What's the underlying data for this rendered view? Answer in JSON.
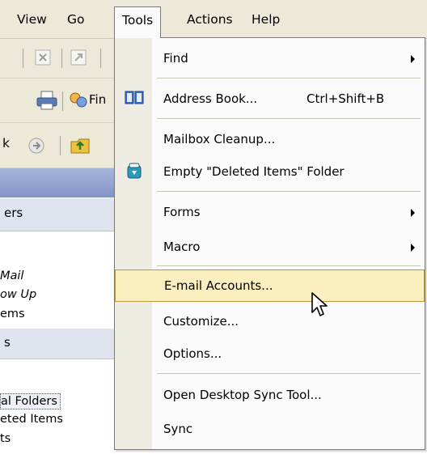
{
  "menubar": {
    "items": [
      {
        "label": "View"
      },
      {
        "label": "Go"
      },
      {
        "label": "Tools"
      },
      {
        "label": "Actions"
      },
      {
        "label": "Help"
      }
    ]
  },
  "toolbar": {
    "find_label": "Fin",
    "back_label": "k"
  },
  "nav": {
    "section1_label": "ers",
    "items1": [
      "Mail",
      "ow Up",
      "ems"
    ],
    "section2_label": "s",
    "items2": [
      "al Folders",
      "eted Items",
      "ts"
    ]
  },
  "tools_menu": {
    "items": [
      {
        "label": "Find",
        "submenu": true
      },
      {
        "label": "Address Book...",
        "shortcut": "Ctrl+Shift+B",
        "icon": "address-book-icon"
      },
      {
        "label": "Mailbox Cleanup..."
      },
      {
        "label": "Empty \"Deleted Items\" Folder",
        "icon": "recycle-bin-icon"
      },
      {
        "label": "Forms",
        "submenu": true
      },
      {
        "label": "Macro",
        "submenu": true
      },
      {
        "label": "E-mail Accounts...",
        "highlighted": true
      },
      {
        "label": "Customize..."
      },
      {
        "label": "Options..."
      },
      {
        "label": "Open Desktop Sync Tool..."
      },
      {
        "label": "Sync"
      }
    ]
  },
  "colors": {
    "menubar_bg": "#ece9d8",
    "highlight_bg": "#fbefc0",
    "highlight_border": "#b79a45",
    "nav_header": "#8193c6"
  }
}
